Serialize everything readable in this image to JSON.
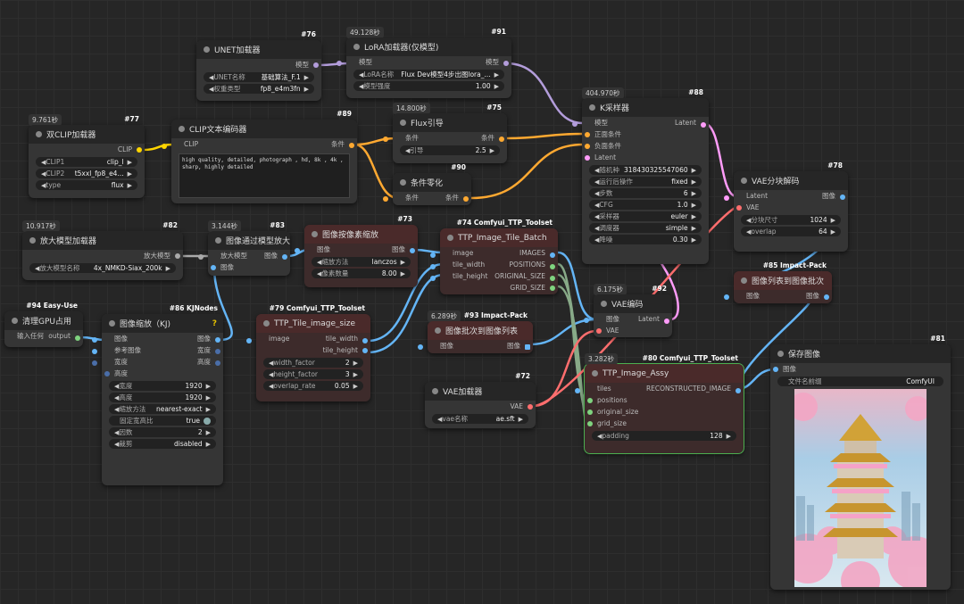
{
  "nodes": {
    "n76": {
      "badge": "#76",
      "title": "UNET加载器",
      "out": "模型",
      "w1": {
        "label": "UNET名称",
        "value": "基础算法_F.1"
      },
      "w2": {
        "label": "权重类型",
        "value": "fp8_e4m3fn"
      }
    },
    "n91": {
      "badge": "#91",
      "time": "49.128秒",
      "title": "LoRA加载器(仅模型)",
      "in": "模型",
      "out": "模型",
      "w1": {
        "label": "LoRA名称",
        "value": "Flux Dev模型4步出图lora_..."
      },
      "w2": {
        "label": "模型强度",
        "value": "1.00"
      }
    },
    "n77": {
      "badge": "#77",
      "time": "9.761秒",
      "title": "双CLIP加载器",
      "out": "CLIP",
      "w1": {
        "label": "CLIP1",
        "value": "clip_l"
      },
      "w2": {
        "label": "CLIP2",
        "value": "t5xxl_fp8_e4..."
      },
      "w3": {
        "label": "type",
        "value": "flux"
      }
    },
    "n89": {
      "badge": "#89",
      "title": "CLIP文本编码器",
      "in": "CLIP",
      "out": "条件",
      "text": "high quality, detailed, photograph , hd, 8k , 4k , sharp, highly detailed"
    },
    "n75": {
      "badge": "#75",
      "time": "14.800秒",
      "title": "Flux引导",
      "in": "条件",
      "out": "条件",
      "w1": {
        "label": "引导",
        "value": "2.5"
      }
    },
    "n90": {
      "badge": "#90",
      "title": "条件零化",
      "in": "条件",
      "out": "条件"
    },
    "n88": {
      "badge": "#88",
      "time": "404.970秒",
      "title": "K采样器",
      "in1": "模型",
      "in2": "正面条件",
      "in3": "负面条件",
      "in4": "Latent",
      "out": "Latent",
      "w": [
        {
          "label": "随机种",
          "value": "318430325547060"
        },
        {
          "label": "运行后操作",
          "value": "fixed"
        },
        {
          "label": "步数",
          "value": "6"
        },
        {
          "label": "CFG",
          "value": "1.0"
        },
        {
          "label": "采样器",
          "value": "euler"
        },
        {
          "label": "调度器",
          "value": "simple"
        },
        {
          "label": "降噪",
          "value": "0.30"
        }
      ]
    },
    "n78": {
      "badge": "#78",
      "title": "VAE分块解码",
      "in1": "Latent",
      "in2": "VAE",
      "out": "图像",
      "w1": {
        "label": "分块尺寸",
        "value": "1024"
      },
      "w2": {
        "label": "overlap",
        "value": "64"
      }
    },
    "n82": {
      "badge": "#82",
      "time": "10.917秒",
      "title": "放大模型加载器",
      "out": "放大模型",
      "w1": {
        "label": "放大模型名称",
        "value": "4x_NMKD-Siax_200k"
      }
    },
    "n83": {
      "badge": "#83",
      "time": "3.144秒",
      "title": "图像通过模型放大",
      "in1": "放大模型",
      "in2": "图像",
      "out": "图像"
    },
    "n73": {
      "badge": "#73",
      "title": "图像按像素缩放",
      "in": "图像",
      "out": "图像",
      "w1": {
        "label": "缩放方法",
        "value": "lanczos"
      },
      "w2": {
        "label": "像素数量",
        "value": "8.00"
      }
    },
    "n74": {
      "badge": "#74 Comfyui_TTP_Toolset",
      "title": "TTP_Image_Tile_Batch",
      "in1": "image",
      "in2": "tile_width",
      "in3": "tile_height",
      "o1": "IMAGES",
      "o2": "POSITIONS",
      "o3": "ORIGINAL_SIZE",
      "o4": "GRID_SIZE"
    },
    "n94": {
      "badge": "#94 Easy-Use",
      "title": "清理GPU占用",
      "in": "输入任何",
      "out": "output"
    },
    "n86": {
      "badge": "#86 KJNodes",
      "title": "图像缩放（KJ)",
      "in1": "图像",
      "in2": "参考图像",
      "in3": "宽度",
      "in4": "高度",
      "o1": "图像",
      "o2": "宽度",
      "o3": "高度",
      "w": [
        {
          "label": "宽度",
          "value": "1920"
        },
        {
          "label": "高度",
          "value": "1920"
        },
        {
          "label": "缩放方法",
          "value": "nearest-exact"
        },
        {
          "label": "固定宽高比",
          "value": "true"
        },
        {
          "label": "因数",
          "value": "2"
        },
        {
          "label": "裁剪",
          "value": "disabled"
        }
      ]
    },
    "n79": {
      "badge": "#79 Comfyui_TTP_Toolset",
      "title": "TTP_Tile_image_size",
      "in": "image",
      "o1": "tile_width",
      "o2": "tile_height",
      "w1": {
        "label": "width_factor",
        "value": "2"
      },
      "w2": {
        "label": "height_factor",
        "value": "3"
      },
      "w3": {
        "label": "overlap_rate",
        "value": "0.05"
      }
    },
    "n93": {
      "badge": "#93 Impact-Pack",
      "time": "6.289秒",
      "title": "图像批次到图像列表",
      "in": "图像",
      "out": "图像"
    },
    "n92": {
      "badge": "#92",
      "time": "6.175秒",
      "title": "VAE编码",
      "in1": "图像",
      "in2": "VAE",
      "out": "Latent"
    },
    "n85": {
      "badge": "#85 Impact-Pack",
      "title": "图像列表到图像批次",
      "in": "图像",
      "out": "图像"
    },
    "n72": {
      "badge": "#72",
      "title": "VAE加载器",
      "out": "VAE",
      "w1": {
        "label": "vae名称",
        "value": "ae.sft"
      }
    },
    "n80": {
      "badge": "#80 Comfyui_TTP_Toolset",
      "time": "3.282秒",
      "title": "TTP_Image_Assy",
      "in1": "tiles",
      "in2": "positions",
      "in3": "original_size",
      "in4": "grid_size",
      "out": "RECONSTRUCTED_IMAGE",
      "w1": {
        "label": "padding",
        "value": "128"
      }
    },
    "n81": {
      "badge": "#81",
      "title": "保存图像",
      "in": "图像",
      "w1": {
        "label": "文件名前缀",
        "value": "ComfyUI"
      }
    }
  }
}
